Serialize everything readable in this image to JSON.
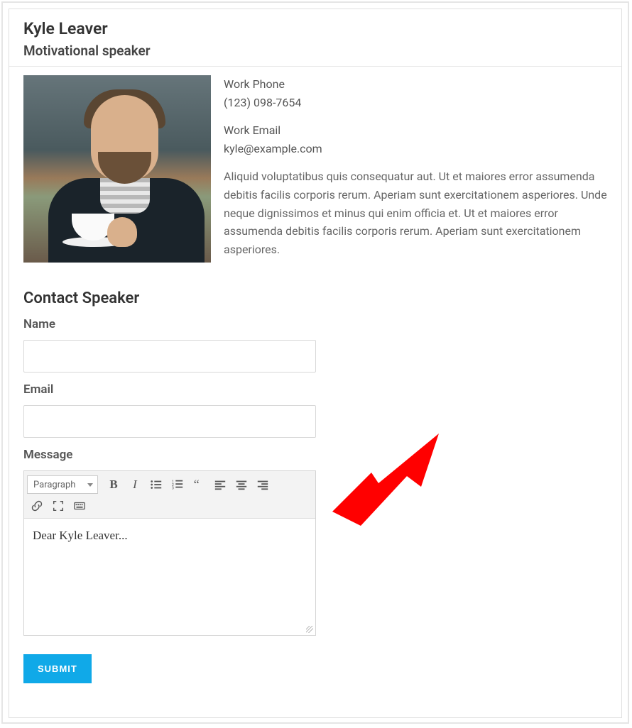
{
  "speaker": {
    "name": "Kyle Leaver",
    "title": "Motivational speaker",
    "phone_label": "Work Phone",
    "phone_value": "(123) 098-7654",
    "email_label": "Work Email",
    "email_value": "kyle@example.com",
    "bio": "Aliquid voluptatibus quis consequatur aut. Ut et maiores error assumenda debitis facilis corporis rerum. Aperiam sunt exercitationem asperiores. Unde neque dignissimos et minus qui enim officia et. Ut et maiores error assumenda debitis facilis corporis rerum. Aperiam sunt exercitationem asperiores."
  },
  "form": {
    "heading": "Contact Speaker",
    "name_label": "Name",
    "name_value": "",
    "email_label": "Email",
    "email_value": "",
    "message_label": "Message",
    "message_value": "Dear Kyle Leaver...",
    "submit_label": "Submit"
  },
  "editor_toolbar": {
    "format_selected": "Paragraph",
    "buttons_row1": [
      "bold",
      "italic",
      "bullet-list",
      "numbered-list",
      "blockquote",
      "align-left",
      "align-center",
      "align-right"
    ],
    "buttons_row2": [
      "link",
      "fullscreen",
      "keyboard-help"
    ]
  },
  "annotation": {
    "arrow_color": "#ff0000"
  }
}
